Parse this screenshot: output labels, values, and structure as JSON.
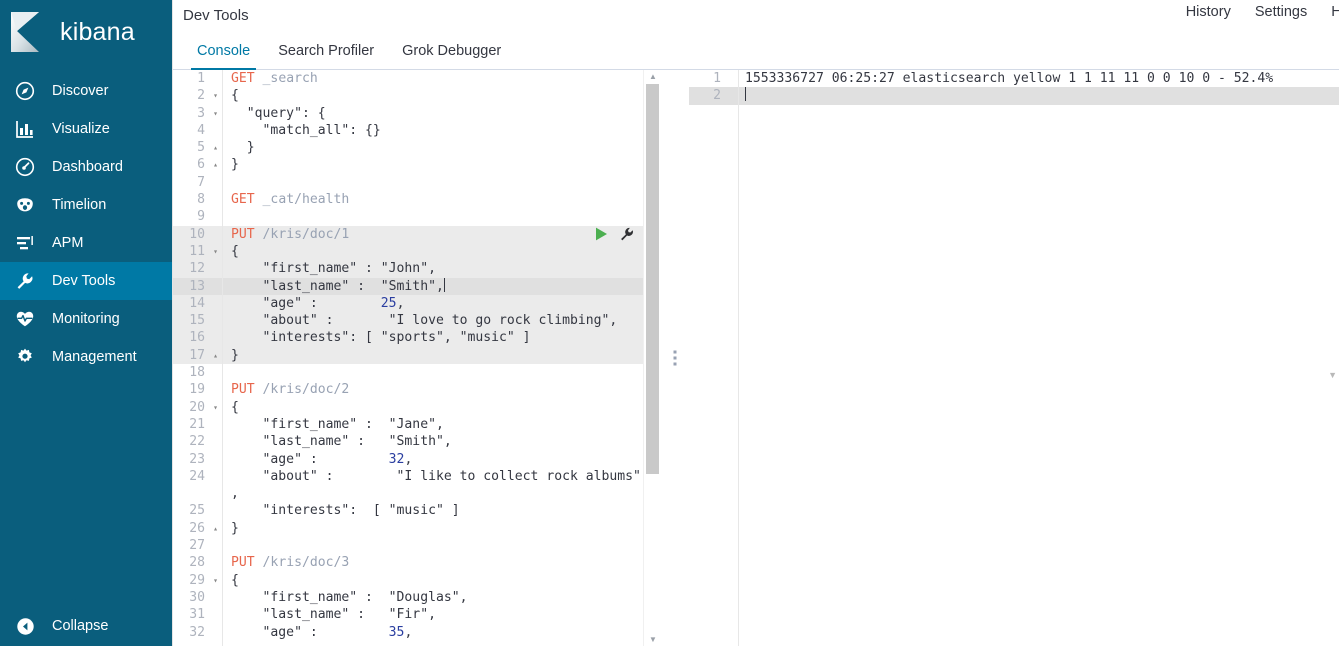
{
  "brand": {
    "name": "kibana",
    "logo_icon": "kibana-k-logo"
  },
  "sidebar": {
    "items": [
      {
        "label": "Discover",
        "icon": "compass-icon",
        "active": false
      },
      {
        "label": "Visualize",
        "icon": "bar-chart-icon",
        "active": false
      },
      {
        "label": "Dashboard",
        "icon": "gauge-icon",
        "active": false
      },
      {
        "label": "Timelion",
        "icon": "timelion-icon",
        "active": false
      },
      {
        "label": "APM",
        "icon": "apm-bars-icon",
        "active": false
      },
      {
        "label": "Dev Tools",
        "icon": "wrench-icon",
        "active": true
      },
      {
        "label": "Monitoring",
        "icon": "heart-pulse-icon",
        "active": false
      },
      {
        "label": "Management",
        "icon": "gear-icon",
        "active": false
      }
    ],
    "collapse": {
      "label": "Collapse",
      "icon": "chevron-left-circle-icon"
    }
  },
  "header": {
    "title": "Dev Tools",
    "links": [
      {
        "label": "History"
      },
      {
        "label": "Settings"
      },
      {
        "label": "Hel"
      }
    ]
  },
  "tabs": [
    {
      "label": "Console",
      "active": true
    },
    {
      "label": "Search Profiler",
      "active": false
    },
    {
      "label": "Grok Debugger",
      "active": false
    }
  ],
  "editor": {
    "run_icon": "play-triangle-icon",
    "wrench_icon": "wrench-icon",
    "splitter_icon": "drag-handle-dots-icon",
    "scroll_up_icon": "caret-up-icon",
    "scroll_down_icon": "caret-down-icon",
    "lines": [
      {
        "n": "1",
        "fold": "",
        "sel": false,
        "active": false,
        "tokens": [
          {
            "t": "method",
            "v": "GET"
          },
          {
            "t": "plain",
            "v": " "
          },
          {
            "t": "url",
            "v": "_search"
          }
        ]
      },
      {
        "n": "2",
        "fold": "▾",
        "sel": false,
        "active": false,
        "tokens": [
          {
            "t": "brace",
            "v": "{"
          }
        ]
      },
      {
        "n": "3",
        "fold": "▾",
        "sel": false,
        "active": false,
        "tokens": [
          {
            "t": "key",
            "v": "  \"query\": {"
          }
        ]
      },
      {
        "n": "4",
        "fold": "",
        "sel": false,
        "active": false,
        "tokens": [
          {
            "t": "key",
            "v": "    \"match_all\": {}"
          }
        ]
      },
      {
        "n": "5",
        "fold": "▴",
        "sel": false,
        "active": false,
        "tokens": [
          {
            "t": "brace",
            "v": "  }"
          }
        ]
      },
      {
        "n": "6",
        "fold": "▴",
        "sel": false,
        "active": false,
        "tokens": [
          {
            "t": "brace",
            "v": "}"
          }
        ]
      },
      {
        "n": "7",
        "fold": "",
        "sel": false,
        "active": false,
        "tokens": []
      },
      {
        "n": "8",
        "fold": "",
        "sel": false,
        "active": false,
        "tokens": [
          {
            "t": "method",
            "v": "GET"
          },
          {
            "t": "plain",
            "v": " "
          },
          {
            "t": "url",
            "v": "_cat/health"
          }
        ]
      },
      {
        "n": "9",
        "fold": "",
        "sel": false,
        "active": false,
        "tokens": []
      },
      {
        "n": "10",
        "fold": "",
        "sel": true,
        "active": false,
        "tokens": [
          {
            "t": "method",
            "v": "PUT"
          },
          {
            "t": "plain",
            "v": " "
          },
          {
            "t": "url",
            "v": "/kris/doc/1"
          }
        ]
      },
      {
        "n": "11",
        "fold": "▾",
        "sel": true,
        "active": false,
        "tokens": [
          {
            "t": "brace",
            "v": "{"
          }
        ]
      },
      {
        "n": "12",
        "fold": "",
        "sel": true,
        "active": false,
        "tokens": [
          {
            "t": "str",
            "v": "    \"first_name\" : \"John\","
          }
        ]
      },
      {
        "n": "13",
        "fold": "",
        "sel": true,
        "active": true,
        "tokens": [
          {
            "t": "str",
            "v": "    \"last_name\" :  \"Smith\","
          },
          {
            "t": "caret",
            "v": ""
          }
        ]
      },
      {
        "n": "14",
        "fold": "",
        "sel": true,
        "active": false,
        "tokens": [
          {
            "t": "str",
            "v": "    \"age\" :        "
          },
          {
            "t": "num",
            "v": "25"
          },
          {
            "t": "punc",
            "v": ","
          }
        ]
      },
      {
        "n": "15",
        "fold": "",
        "sel": true,
        "active": false,
        "tokens": [
          {
            "t": "str",
            "v": "    \"about\" :       \"I love to go rock climbing\","
          }
        ]
      },
      {
        "n": "16",
        "fold": "",
        "sel": true,
        "active": false,
        "tokens": [
          {
            "t": "str",
            "v": "    \"interests\": [ \"sports\", \"music\" ]"
          }
        ]
      },
      {
        "n": "17",
        "fold": "▴",
        "sel": true,
        "active": false,
        "tokens": [
          {
            "t": "brace",
            "v": "}"
          }
        ]
      },
      {
        "n": "18",
        "fold": "",
        "sel": false,
        "active": false,
        "tokens": []
      },
      {
        "n": "19",
        "fold": "",
        "sel": false,
        "active": false,
        "tokens": [
          {
            "t": "method",
            "v": "PUT"
          },
          {
            "t": "plain",
            "v": " "
          },
          {
            "t": "url",
            "v": "/kris/doc/2"
          }
        ]
      },
      {
        "n": "20",
        "fold": "▾",
        "sel": false,
        "active": false,
        "tokens": [
          {
            "t": "brace",
            "v": "{"
          }
        ]
      },
      {
        "n": "21",
        "fold": "",
        "sel": false,
        "active": false,
        "tokens": [
          {
            "t": "str",
            "v": "    \"first_name\" :  \"Jane\","
          }
        ]
      },
      {
        "n": "22",
        "fold": "",
        "sel": false,
        "active": false,
        "tokens": [
          {
            "t": "str",
            "v": "    \"last_name\" :   \"Smith\","
          }
        ]
      },
      {
        "n": "23",
        "fold": "",
        "sel": false,
        "active": false,
        "tokens": [
          {
            "t": "str",
            "v": "    \"age\" :         "
          },
          {
            "t": "num",
            "v": "32"
          },
          {
            "t": "punc",
            "v": ","
          }
        ]
      },
      {
        "n": "24",
        "fold": "",
        "sel": false,
        "active": false,
        "tokens": [
          {
            "t": "str",
            "v": "    \"about\" :        \"I like to collect rock albums\""
          }
        ]
      },
      {
        "n": "",
        "fold": "",
        "sel": false,
        "active": false,
        "tokens": [
          {
            "t": "punc",
            "v": ","
          }
        ]
      },
      {
        "n": "25",
        "fold": "",
        "sel": false,
        "active": false,
        "tokens": [
          {
            "t": "str",
            "v": "    \"interests\":  [ \"music\" ]"
          }
        ]
      },
      {
        "n": "26",
        "fold": "▴",
        "sel": false,
        "active": false,
        "tokens": [
          {
            "t": "brace",
            "v": "}"
          }
        ]
      },
      {
        "n": "27",
        "fold": "",
        "sel": false,
        "active": false,
        "tokens": []
      },
      {
        "n": "28",
        "fold": "",
        "sel": false,
        "active": false,
        "tokens": [
          {
            "t": "method",
            "v": "PUT"
          },
          {
            "t": "plain",
            "v": " "
          },
          {
            "t": "url",
            "v": "/kris/doc/3"
          }
        ]
      },
      {
        "n": "29",
        "fold": "▾",
        "sel": false,
        "active": false,
        "tokens": [
          {
            "t": "brace",
            "v": "{"
          }
        ]
      },
      {
        "n": "30",
        "fold": "",
        "sel": false,
        "active": false,
        "tokens": [
          {
            "t": "str",
            "v": "    \"first_name\" :  \"Douglas\","
          }
        ]
      },
      {
        "n": "31",
        "fold": "",
        "sel": false,
        "active": false,
        "tokens": [
          {
            "t": "str",
            "v": "    \"last_name\" :   \"Fir\","
          }
        ]
      },
      {
        "n": "32",
        "fold": "",
        "sel": false,
        "active": false,
        "tokens": [
          {
            "t": "str",
            "v": "    \"age\" :         "
          },
          {
            "t": "num",
            "v": "35"
          },
          {
            "t": "punc",
            "v": ","
          }
        ]
      }
    ]
  },
  "output": {
    "lines": [
      {
        "n": "1",
        "text": "1553336727 06:25:27 elasticsearch yellow 1 1 11 11 0 0 10 0 - 52.4%",
        "active": false
      },
      {
        "n": "2",
        "text": "",
        "active": true
      }
    ]
  },
  "colors": {
    "sidebar_bg": "#0a5e7d",
    "sidebar_active": "#0079a5",
    "accent": "#0079a5",
    "method": "#e7664c",
    "url": "#98a2b3",
    "number": "#2a3ea0",
    "text": "#343741",
    "selection": "#ebebeb",
    "active_line": "#e0e0e0",
    "run_green": "#4caf50"
  }
}
